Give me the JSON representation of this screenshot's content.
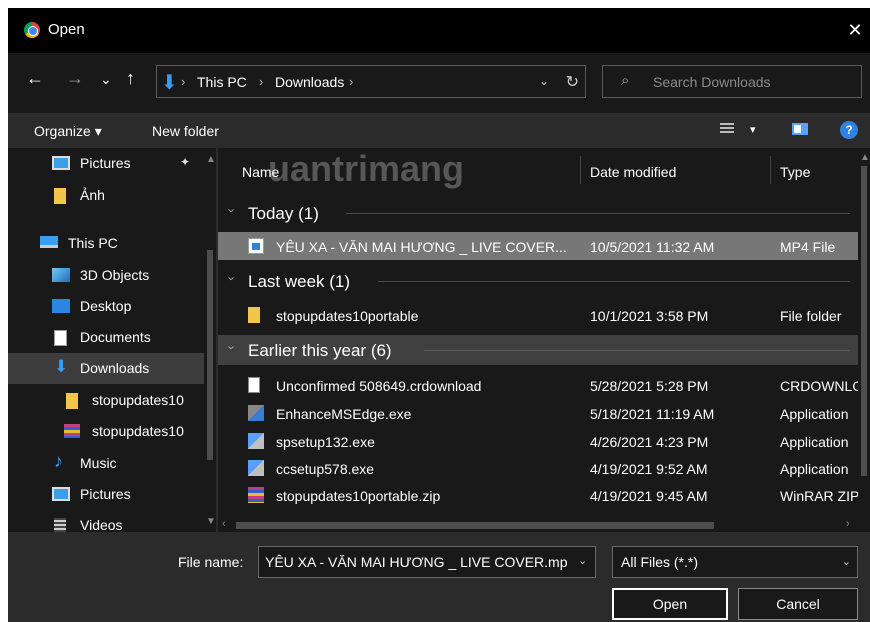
{
  "window": {
    "title": "Open",
    "close_glyph": "✕"
  },
  "nav": {
    "back": "←",
    "forward": "→",
    "recent": "⌄",
    "up": "↑"
  },
  "address": {
    "icon": "download-arrow-icon",
    "crumbs": [
      "This PC",
      "Downloads"
    ],
    "sep": "›",
    "dropdown": "⌄",
    "refresh": "↻"
  },
  "search": {
    "placeholder": "Search Downloads",
    "icon": "search-icon"
  },
  "toolbar": {
    "organize": "Organize ▾",
    "new_folder": "New folder",
    "view_caret": "▾",
    "help": "?"
  },
  "sidebar": {
    "items": [
      {
        "label": "Pictures",
        "icon": "pictures-icon"
      },
      {
        "label": "Ảnh",
        "icon": "folder-icon"
      },
      {
        "label": "This PC",
        "icon": "computer-icon"
      },
      {
        "label": "3D Objects",
        "icon": "3d-objects-icon"
      },
      {
        "label": "Desktop",
        "icon": "desktop-icon"
      },
      {
        "label": "Documents",
        "icon": "documents-icon"
      },
      {
        "label": "Downloads",
        "icon": "downloads-icon"
      },
      {
        "label": "stopupdates10",
        "icon": "folder-icon"
      },
      {
        "label": "stopupdates10",
        "icon": "winrar-icon"
      },
      {
        "label": "Music",
        "icon": "music-icon"
      },
      {
        "label": "Pictures",
        "icon": "pictures-icon"
      },
      {
        "label": "Videos",
        "icon": "videos-icon"
      }
    ],
    "pin": "📌"
  },
  "columns": {
    "name": "Name",
    "date": "Date modified",
    "type": "Type"
  },
  "watermark": "uantrimang",
  "groups": [
    {
      "title": "Today (1)"
    },
    {
      "title": "Last week (1)"
    },
    {
      "title": "Earlier this year (6)"
    }
  ],
  "files": [
    {
      "name": "YÊU XA - VĂN MAI HƯƠNG _ LIVE COVER...",
      "date": "10/5/2021 11:32 AM",
      "type": "MP4 File",
      "icon": "mp4-file-icon"
    },
    {
      "name": "stopupdates10portable",
      "date": "10/1/2021 3:58 PM",
      "type": "File folder",
      "icon": "folder-icon"
    },
    {
      "name": "Unconfirmed 508649.crdownload",
      "date": "5/28/2021 5:28 PM",
      "type": "CRDOWNLO",
      "icon": "document-icon"
    },
    {
      "name": "EnhanceMSEdge.exe",
      "date": "5/18/2021 11:19 AM",
      "type": "Application",
      "icon": "exe-icon"
    },
    {
      "name": "spsetup132.exe",
      "date": "4/26/2021 4:23 PM",
      "type": "Application",
      "icon": "setup-icon"
    },
    {
      "name": "ccsetup578.exe",
      "date": "4/19/2021 9:52 AM",
      "type": "Application",
      "icon": "setup-icon"
    },
    {
      "name": "stopupdates10portable.zip",
      "date": "4/19/2021 9:45 AM",
      "type": "WinRAR ZIP",
      "icon": "winrar-icon"
    }
  ],
  "footer": {
    "filename_label": "File name:",
    "filename_value": "YÊU XA - VĂN MAI HƯƠNG _ LIVE COVER.mp",
    "filter": "All Files (*.*)",
    "dropdown": "⌄",
    "open": "Open",
    "cancel": "Cancel"
  }
}
